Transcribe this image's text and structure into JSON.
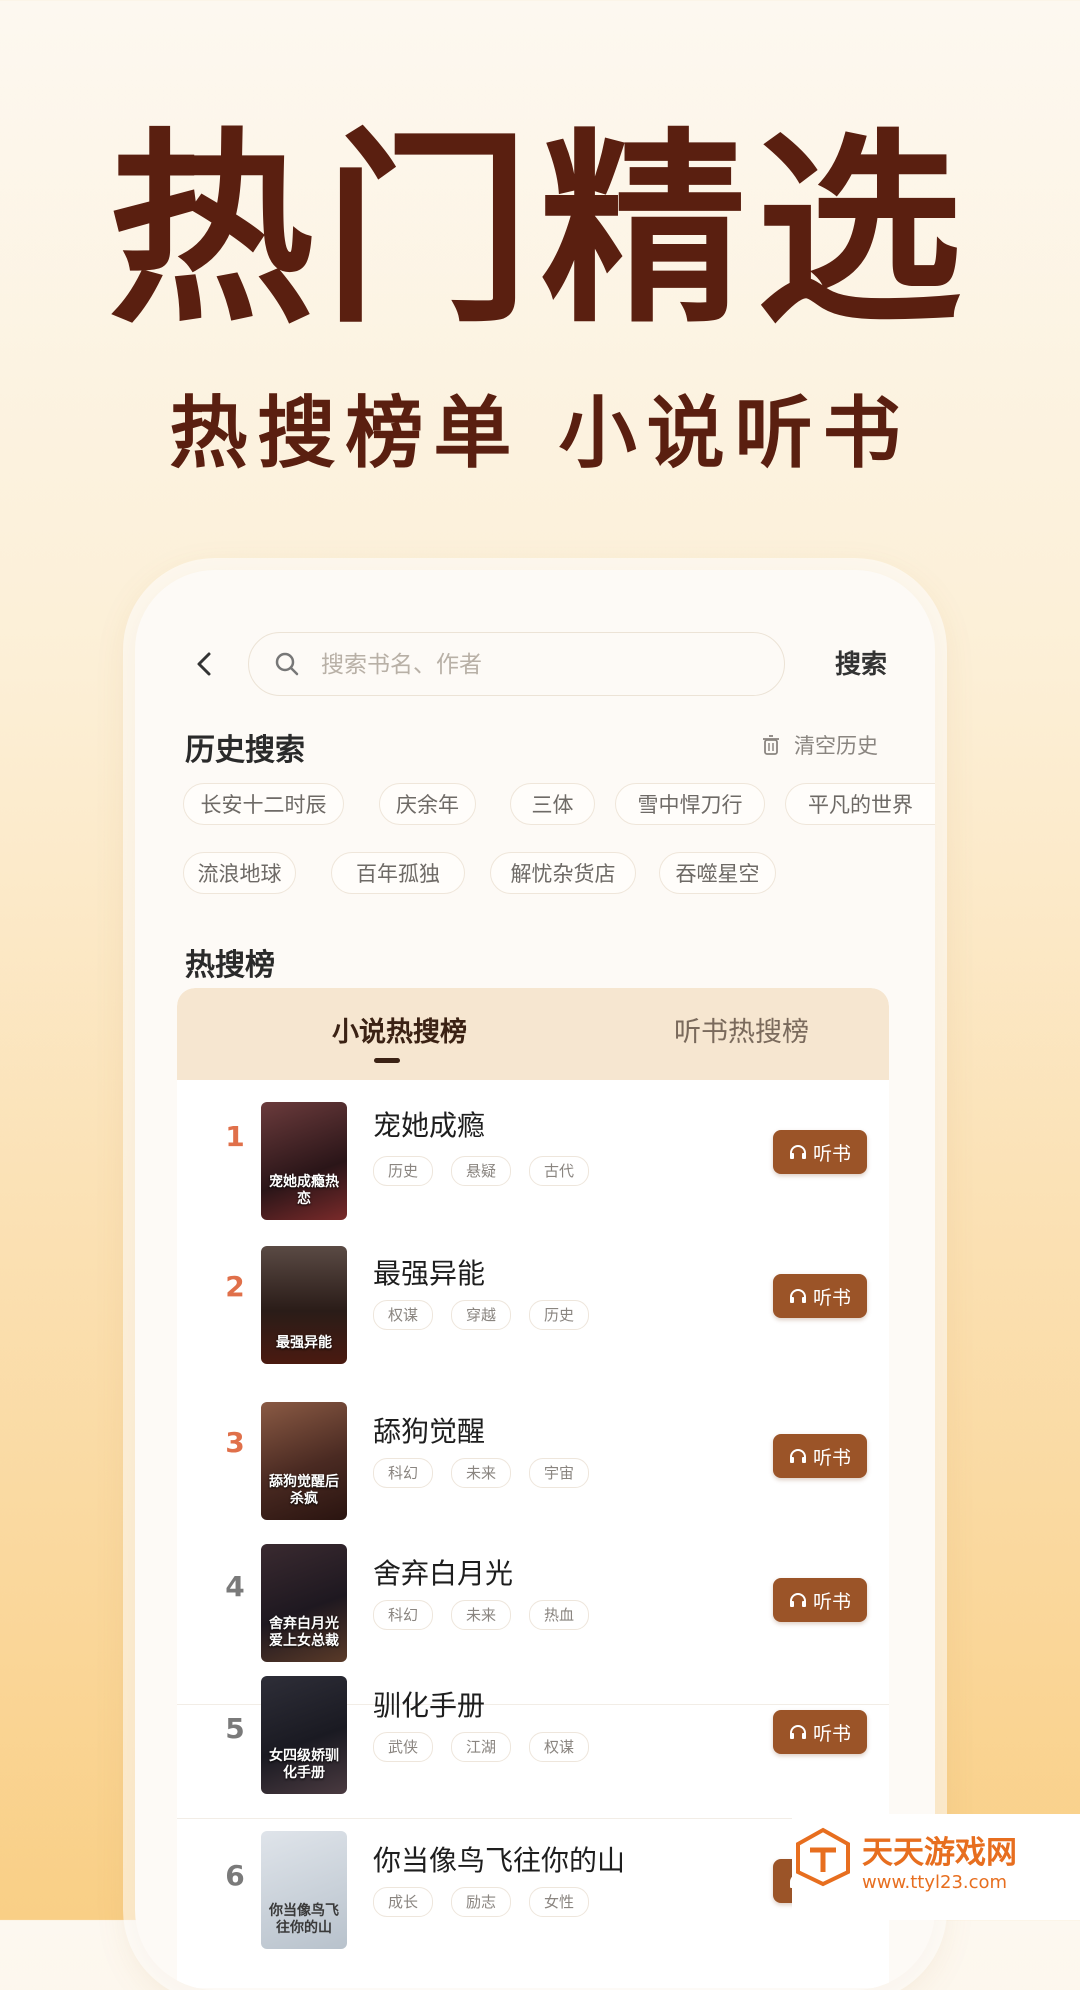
{
  "headline": "热门精选",
  "subheadline": "热搜榜单 小说听书",
  "search": {
    "placeholder": "搜索书名、作者",
    "button_label": "搜索"
  },
  "history": {
    "title": "历史搜索",
    "clear_label": "清空历史",
    "chips": [
      "长安十二时辰",
      "庆余年",
      "三体",
      "雪中悍刀行",
      "平凡的世界",
      "流浪地球",
      "百年孤独",
      "解忧杂货店",
      "吞噬星空"
    ]
  },
  "hot": {
    "title": "热搜榜",
    "tabs": [
      {
        "label": "小说热搜榜",
        "active": true
      },
      {
        "label": "听书热搜榜",
        "active": false
      }
    ],
    "listen_label": "听书",
    "items": [
      {
        "rank": "1",
        "title": "宠她成瘾",
        "tags": [
          "历史",
          "悬疑",
          "古代"
        ],
        "cover_text": "宠她成瘾热恋",
        "cover_color": "#4a2a2e"
      },
      {
        "rank": "2",
        "title": "最强异能",
        "tags": [
          "权谋",
          "穿越",
          "历史"
        ],
        "cover_text": "最强异能",
        "cover_color": "#3a2a22"
      },
      {
        "rank": "3",
        "title": "舔狗觉醒",
        "tags": [
          "科幻",
          "未来",
          "宇宙"
        ],
        "cover_text": "舔狗觉醒后杀疯",
        "cover_color": "#5a3a30"
      },
      {
        "rank": "4",
        "title": "舍弃白月光",
        "tags": [
          "科幻",
          "未来",
          "热血"
        ],
        "cover_text": "舍弃白月光爱上女总裁",
        "cover_color": "#2e2230"
      },
      {
        "rank": "5",
        "title": "驯化手册",
        "tags": [
          "武侠",
          "江湖",
          "权谋"
        ],
        "cover_text": "女四级娇驯化手册",
        "cover_color": "#2a2a30"
      },
      {
        "rank": "6",
        "title": "你当像鸟飞往你的山",
        "tags": [
          "成长",
          "励志",
          "女性"
        ],
        "cover_text": "你当像鸟飞往你的山",
        "cover_color": "#c8cfd8"
      }
    ]
  },
  "colors": {
    "rank_top3": "#e0704a",
    "rank_other": "#7a7a7a",
    "listen_button": "#9b5428",
    "headline": "#5a1f10"
  },
  "watermark": {
    "name": "天天游戏网",
    "url": "www.ttyl23.com"
  }
}
